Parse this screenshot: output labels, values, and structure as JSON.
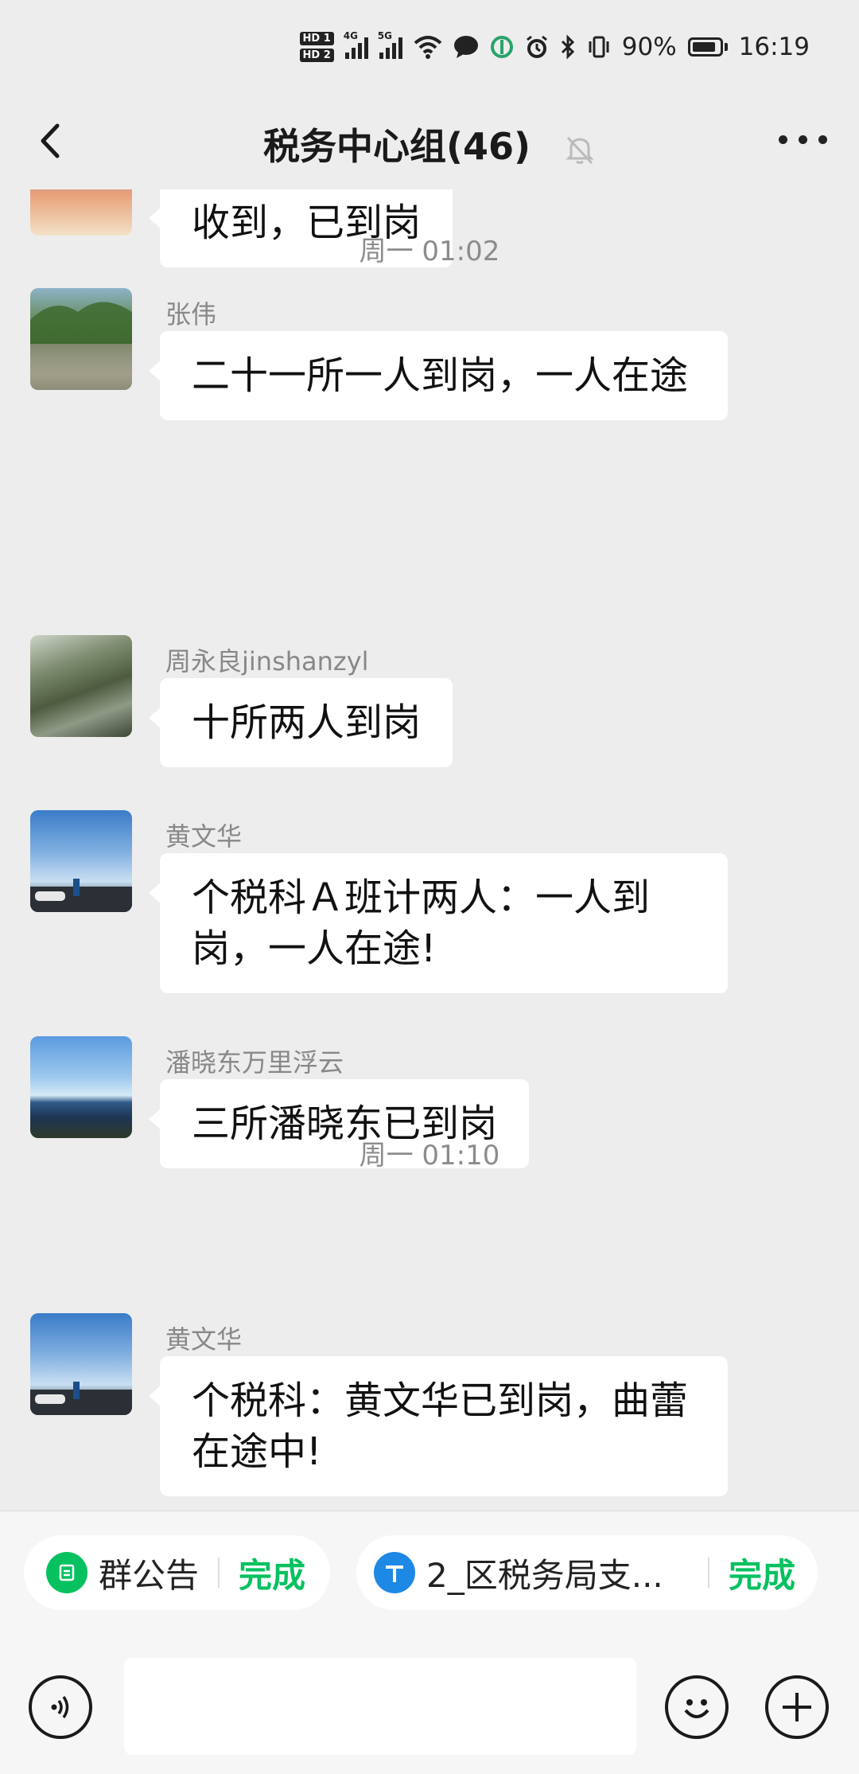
{
  "status_bar": {
    "hd1": "HD 1",
    "hd2": "HD 2",
    "net1": "4G",
    "net2": "5G",
    "battery_percent": "90%",
    "battery_level": 0.9,
    "time": "16:19"
  },
  "header": {
    "title": "税务中心组(46)",
    "back_icon": "chevron-left-icon",
    "mute_icon": "bell-off-icon",
    "more_icon": "more-dots-icon"
  },
  "messages": [
    {
      "text": "收到，已到岗"
    },
    {
      "time": "周一 01:02"
    },
    {
      "sender": "张伟",
      "text": "二十一所一人到岗，一人在途"
    },
    {
      "sender": "周永良jinshanzyl",
      "text": "十所两人到岗"
    },
    {
      "sender": "黄文华",
      "text": "个税科Ａ班计两人：一人到岗，一人在途!"
    },
    {
      "sender": "潘晓东万里浮云",
      "text": "三所潘晓东已到岗"
    },
    {
      "time": "周一 01:10"
    },
    {
      "sender": "黄文华",
      "text": "个税科：黄文华已到岗，曲蕾在途中!"
    }
  ],
  "quick_bar": {
    "announcement_label": "群公告",
    "announcement_action": "完成",
    "task_label": "2_区税务局支...",
    "task_action": "完成",
    "accent_color": "#07c160"
  },
  "input_bar": {
    "voice_icon": "voice-icon",
    "emoji_icon": "emoji-icon",
    "plus_icon": "plus-icon"
  }
}
